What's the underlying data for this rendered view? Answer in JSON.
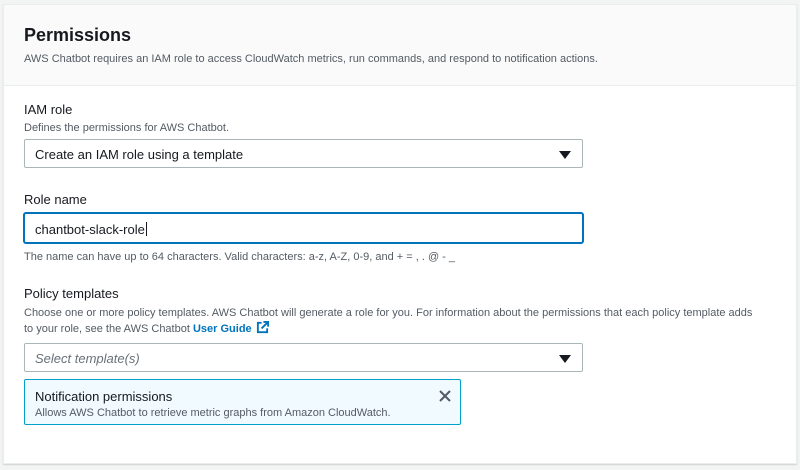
{
  "panel": {
    "title": "Permissions",
    "description": "AWS Chatbot requires an IAM role to access CloudWatch metrics, run commands, and respond to notification actions."
  },
  "iam_role": {
    "label": "IAM role",
    "description": "Defines the permissions for AWS Chatbot.",
    "selected": "Create an IAM role using a template"
  },
  "role_name": {
    "label": "Role name",
    "value": "chantbot-slack-role",
    "constraint": "The name can have up to 64 characters. Valid characters: a-z, A-Z, 0-9, and + = , . @ - _"
  },
  "policy_templates": {
    "label": "Policy templates",
    "description_prefix": "Choose one or more policy templates. AWS Chatbot will generate a role for you. For information about the permissions that each policy template adds to your role, see the AWS Chatbot",
    "link_text": "User Guide",
    "placeholder": "Select template(s)",
    "selected_token": {
      "title": "Notification permissions",
      "description": "Allows AWS Chatbot to retrieve metric graphs from Amazon CloudWatch."
    }
  },
  "icons": {
    "caret": "caret-down-icon",
    "external": "external-link-icon",
    "close": "close-icon"
  },
  "colors": {
    "accent": "#0073bb",
    "token_border": "#00a1c9",
    "token_bg": "#f1faff"
  }
}
